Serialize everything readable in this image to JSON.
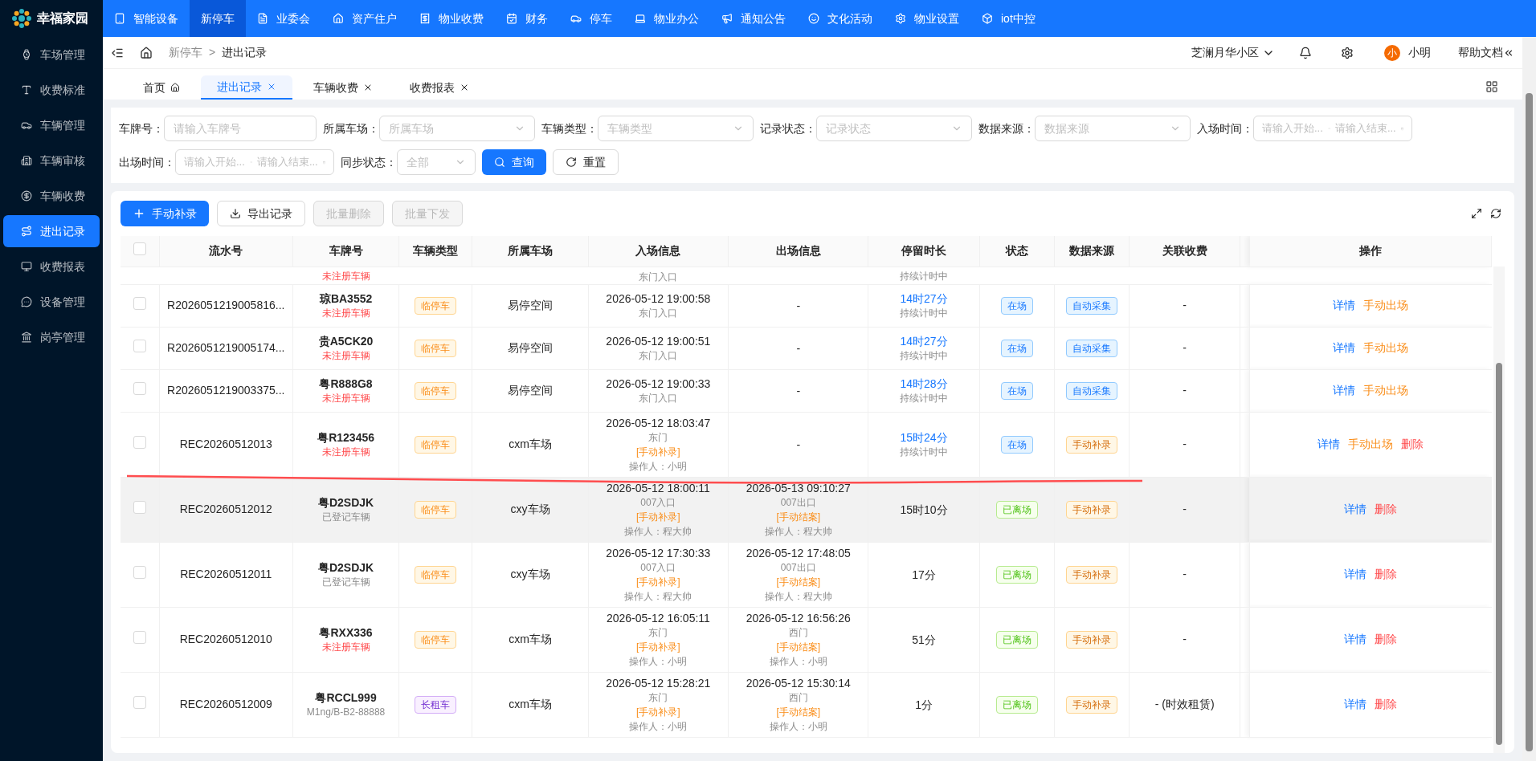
{
  "logo": {
    "text": "幸福家园"
  },
  "top_nav": [
    {
      "label": "智能设备",
      "selected": false
    },
    {
      "label": "新停车",
      "selected": true
    },
    {
      "label": "业委会",
      "selected": false
    },
    {
      "label": "资产住户",
      "selected": false
    },
    {
      "label": "物业收费",
      "selected": false
    },
    {
      "label": "财务",
      "selected": false
    },
    {
      "label": "停车",
      "selected": false
    },
    {
      "label": "物业办公",
      "selected": false
    },
    {
      "label": "通知公告",
      "selected": false
    },
    {
      "label": "文化活动",
      "selected": false
    },
    {
      "label": "物业设置",
      "selected": false
    },
    {
      "label": "iot中控",
      "selected": false
    }
  ],
  "sidebar": {
    "items": [
      {
        "label": "车场管理",
        "selected": false
      },
      {
        "label": "收费标准",
        "selected": false
      },
      {
        "label": "车辆管理",
        "selected": false
      },
      {
        "label": "车辆审核",
        "selected": false
      },
      {
        "label": "车辆收费",
        "selected": false
      },
      {
        "label": "进出记录",
        "selected": true
      },
      {
        "label": "收费报表",
        "selected": false
      },
      {
        "label": "设备管理",
        "selected": false
      },
      {
        "label": "岗亭管理",
        "selected": false
      }
    ]
  },
  "breadcrumb": [
    "新停车",
    "进出记录"
  ],
  "breadcrumb_separator": ">",
  "header_right": {
    "community": "芝澜月华小区",
    "avatar": "小",
    "user": "小明",
    "help": "帮助文档"
  },
  "tabs": [
    {
      "label": "首页",
      "selected": false,
      "closable": false
    },
    {
      "label": "进出记录",
      "selected": true,
      "closable": true
    },
    {
      "label": "车辆收费",
      "selected": false,
      "closable": true
    },
    {
      "label": "收费报表",
      "selected": false,
      "closable": true
    }
  ],
  "filters": [
    {
      "label": "车牌号：",
      "kind": "input",
      "placeholder": "请输入车牌号"
    },
    {
      "label": "所属车场：",
      "kind": "select",
      "placeholder": "所属车场"
    },
    {
      "label": "车辆类型：",
      "kind": "select",
      "placeholder": "车辆类型"
    },
    {
      "label": "记录状态：",
      "kind": "select",
      "placeholder": "记录状态"
    },
    {
      "label": "数据来源：",
      "kind": "select",
      "placeholder": "数据来源"
    },
    {
      "label": "入场时间：",
      "kind": "range",
      "placeholder": "请输入开始...",
      "placeholder_end": "请输入结束..."
    },
    {
      "label": "出场时间：",
      "kind": "range",
      "placeholder": "请输入开始...",
      "placeholder_end": "请输入结束..."
    },
    {
      "label": "同步状态：",
      "kind": "select",
      "placeholder": "全部"
    }
  ],
  "filter_buttons": [
    {
      "label": "查询",
      "kind": "primary"
    },
    {
      "label": "重置",
      "kind": "default"
    }
  ],
  "toolbar": [
    {
      "label": "手动补录",
      "kind": "primary",
      "disabled": false
    },
    {
      "label": "导出记录",
      "kind": "export",
      "disabled": false
    },
    {
      "label": "批量删除",
      "kind": "default",
      "disabled": true
    },
    {
      "label": "批量下发",
      "kind": "default",
      "disabled": true
    }
  ],
  "table": {
    "columns": [
      "流水号",
      "车牌号",
      "车辆类型",
      "所属车场",
      "入场信息",
      "出场信息",
      "停留时长",
      "状态",
      "数据来源",
      "关联收费",
      "操作"
    ],
    "header_checked": false,
    "rows": [
      {
        "kind": "partial",
        "plate_note": {
          "text": "未注册车辆",
          "kind": "warning"
        },
        "entry": [
          {
            "text": "东门入口",
            "kind": "place"
          }
        ],
        "duration_note": "持续计时中"
      },
      {
        "kind": "record",
        "checked": false,
        "highlighted": false,
        "serial": "R2026051219005816...",
        "plate": "琼BA3552",
        "plate_note": {
          "text": "未注册车辆",
          "kind": "warning"
        },
        "type": {
          "text": "临停车",
          "kind": "temporary"
        },
        "lot": "易停空间",
        "entry": [
          {
            "text": "2026-05-12 19:00:58",
            "kind": "time"
          },
          {
            "text": "东门入口",
            "kind": "place"
          }
        ],
        "exit": [
          {
            "text": "-",
            "kind": "time"
          }
        ],
        "duration": {
          "text": "14时27分",
          "running": true,
          "note": "持续计时中"
        },
        "status": {
          "text": "在场",
          "kind": "present"
        },
        "source": {
          "text": "自动采集",
          "kind": "auto"
        },
        "fee": "-",
        "actions": [
          {
            "label": "详情",
            "kind": "primary"
          },
          {
            "label": "手动出场",
            "kind": "warning"
          }
        ]
      },
      {
        "kind": "record",
        "checked": false,
        "highlighted": false,
        "serial": "R2026051219005174...",
        "plate": "贵A5CK20",
        "plate_note": {
          "text": "未注册车辆",
          "kind": "warning"
        },
        "type": {
          "text": "临停车",
          "kind": "temporary"
        },
        "lot": "易停空间",
        "entry": [
          {
            "text": "2026-05-12 19:00:51",
            "kind": "time"
          },
          {
            "text": "东门入口",
            "kind": "place"
          }
        ],
        "exit": [
          {
            "text": "-",
            "kind": "time"
          }
        ],
        "duration": {
          "text": "14时27分",
          "running": true,
          "note": "持续计时中"
        },
        "status": {
          "text": "在场",
          "kind": "present"
        },
        "source": {
          "text": "自动采集",
          "kind": "auto"
        },
        "fee": "-",
        "actions": [
          {
            "label": "详情",
            "kind": "primary"
          },
          {
            "label": "手动出场",
            "kind": "warning"
          }
        ]
      },
      {
        "kind": "record",
        "checked": false,
        "highlighted": false,
        "serial": "R2026051219003375...",
        "plate": "粤R888G8",
        "plate_note": {
          "text": "未注册车辆",
          "kind": "warning"
        },
        "type": {
          "text": "临停车",
          "kind": "temporary"
        },
        "lot": "易停空间",
        "entry": [
          {
            "text": "2026-05-12 19:00:33",
            "kind": "time"
          },
          {
            "text": "东门入口",
            "kind": "place"
          }
        ],
        "exit": [
          {
            "text": "-",
            "kind": "time"
          }
        ],
        "duration": {
          "text": "14时28分",
          "running": true,
          "note": "持续计时中"
        },
        "status": {
          "text": "在场",
          "kind": "present"
        },
        "source": {
          "text": "自动采集",
          "kind": "auto"
        },
        "fee": "-",
        "actions": [
          {
            "label": "详情",
            "kind": "primary"
          },
          {
            "label": "手动出场",
            "kind": "warning"
          }
        ]
      },
      {
        "kind": "record",
        "checked": false,
        "highlighted": false,
        "serial": "REC20260512013",
        "plate": "粤R123456",
        "plate_note": {
          "text": "未注册车辆",
          "kind": "warning"
        },
        "type": {
          "text": "临停车",
          "kind": "temporary"
        },
        "lot": "cxm车场",
        "entry": [
          {
            "text": "2026-05-12 18:03:47",
            "kind": "time"
          },
          {
            "text": "东门",
            "kind": "place"
          },
          {
            "text": "[手动补录]",
            "kind": "tag"
          },
          {
            "text": "操作人：小明",
            "kind": "operator"
          }
        ],
        "exit": [
          {
            "text": "-",
            "kind": "time"
          }
        ],
        "duration": {
          "text": "15时24分",
          "running": true,
          "note": "持续计时中"
        },
        "status": {
          "text": "在场",
          "kind": "present"
        },
        "source": {
          "text": "手动补录",
          "kind": "manual"
        },
        "fee": "-",
        "actions": [
          {
            "label": "详情",
            "kind": "primary"
          },
          {
            "label": "手动出场",
            "kind": "warning"
          },
          {
            "label": "删除",
            "kind": "danger"
          }
        ]
      },
      {
        "kind": "record",
        "checked": false,
        "highlighted": true,
        "serial": "REC20260512012",
        "plate": "粤D2SDJK",
        "plate_note": {
          "text": "已登记车辆",
          "kind": "muted"
        },
        "type": {
          "text": "临停车",
          "kind": "temporary"
        },
        "lot": "cxy车场",
        "entry": [
          {
            "text": "2026-05-12 18:00:11",
            "kind": "time"
          },
          {
            "text": "007入口",
            "kind": "place"
          },
          {
            "text": "[手动补录]",
            "kind": "tag"
          },
          {
            "text": "操作人：程大帅",
            "kind": "operator"
          }
        ],
        "exit": [
          {
            "text": "2026-05-13 09:10:27",
            "kind": "time"
          },
          {
            "text": "007出口",
            "kind": "place"
          },
          {
            "text": "[手动结案]",
            "kind": "tag"
          },
          {
            "text": "操作人：程大帅",
            "kind": "operator"
          }
        ],
        "duration": {
          "text": "15时10分",
          "running": false
        },
        "status": {
          "text": "已离场",
          "kind": "left"
        },
        "source": {
          "text": "手动补录",
          "kind": "manual"
        },
        "fee": "-",
        "actions": [
          {
            "label": "详情",
            "kind": "primary"
          },
          {
            "label": "删除",
            "kind": "danger"
          }
        ]
      },
      {
        "kind": "record",
        "checked": false,
        "highlighted": false,
        "serial": "REC20260512011",
        "plate": "粤D2SDJK",
        "plate_note": {
          "text": "已登记车辆",
          "kind": "muted"
        },
        "type": {
          "text": "临停车",
          "kind": "temporary"
        },
        "lot": "cxy车场",
        "entry": [
          {
            "text": "2026-05-12 17:30:33",
            "kind": "time"
          },
          {
            "text": "007入口",
            "kind": "place"
          },
          {
            "text": "[手动补录]",
            "kind": "tag"
          },
          {
            "text": "操作人：程大帅",
            "kind": "operator"
          }
        ],
        "exit": [
          {
            "text": "2026-05-12 17:48:05",
            "kind": "time"
          },
          {
            "text": "007出口",
            "kind": "place"
          },
          {
            "text": "[手动结案]",
            "kind": "tag"
          },
          {
            "text": "操作人：程大帅",
            "kind": "operator"
          }
        ],
        "duration": {
          "text": "17分",
          "running": false
        },
        "status": {
          "text": "已离场",
          "kind": "left"
        },
        "source": {
          "text": "手动补录",
          "kind": "manual"
        },
        "fee": "-",
        "actions": [
          {
            "label": "详情",
            "kind": "primary"
          },
          {
            "label": "删除",
            "kind": "danger"
          }
        ]
      },
      {
        "kind": "record",
        "checked": false,
        "highlighted": false,
        "serial": "REC20260512010",
        "plate": "粤RXX336",
        "plate_note": {
          "text": "未注册车辆",
          "kind": "warning"
        },
        "type": {
          "text": "临停车",
          "kind": "temporary"
        },
        "lot": "cxm车场",
        "entry": [
          {
            "text": "2026-05-12 16:05:11",
            "kind": "time"
          },
          {
            "text": "东门",
            "kind": "place"
          },
          {
            "text": "[手动补录]",
            "kind": "tag"
          },
          {
            "text": "操作人：小明",
            "kind": "operator"
          }
        ],
        "exit": [
          {
            "text": "2026-05-12 16:56:26",
            "kind": "time"
          },
          {
            "text": "西门",
            "kind": "place"
          },
          {
            "text": "[手动结案]",
            "kind": "tag"
          },
          {
            "text": "操作人：小明",
            "kind": "operator"
          }
        ],
        "duration": {
          "text": "51分",
          "running": false
        },
        "status": {
          "text": "已离场",
          "kind": "left"
        },
        "source": {
          "text": "手动补录",
          "kind": "manual"
        },
        "fee": "-",
        "actions": [
          {
            "label": "详情",
            "kind": "primary"
          },
          {
            "label": "删除",
            "kind": "danger"
          }
        ]
      },
      {
        "kind": "record",
        "checked": false,
        "highlighted": false,
        "serial": "REC20260512009",
        "plate": "粤RCCL999",
        "plate_note": {
          "text": "M1ng/B-B2-88888",
          "kind": "muted"
        },
        "type": {
          "text": "长租车",
          "kind": "rental"
        },
        "lot": "cxm车场",
        "entry": [
          {
            "text": "2026-05-12 15:28:21",
            "kind": "time"
          },
          {
            "text": "东门",
            "kind": "place"
          },
          {
            "text": "[手动补录]",
            "kind": "tag"
          },
          {
            "text": "操作人：小明",
            "kind": "operator"
          }
        ],
        "exit": [
          {
            "text": "2026-05-12 15:30:14",
            "kind": "time"
          },
          {
            "text": "西门",
            "kind": "place"
          },
          {
            "text": "[手动结案]",
            "kind": "tag"
          },
          {
            "text": "操作人：小明",
            "kind": "operator"
          }
        ],
        "duration": {
          "text": "1分",
          "running": false
        },
        "status": {
          "text": "已离场",
          "kind": "left"
        },
        "source": {
          "text": "手动补录",
          "kind": "manual"
        },
        "fee": "- (时效租赁)",
        "actions": [
          {
            "label": "详情",
            "kind": "primary"
          },
          {
            "label": "删除",
            "kind": "danger"
          }
        ]
      }
    ]
  }
}
